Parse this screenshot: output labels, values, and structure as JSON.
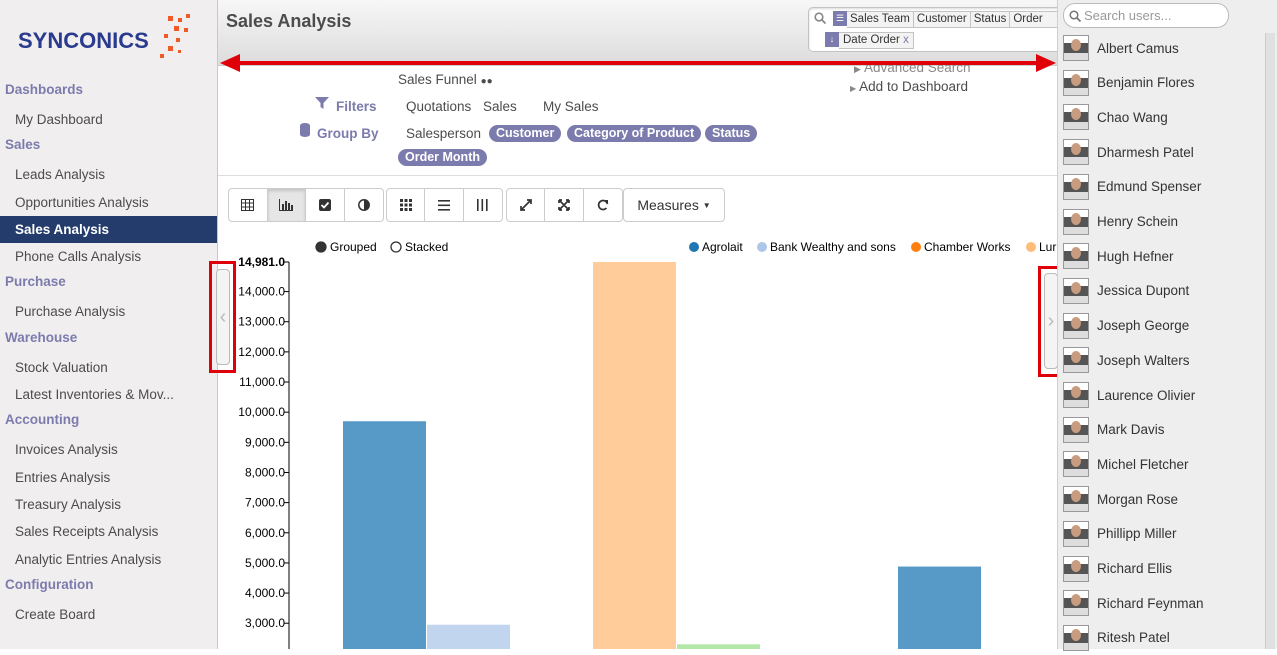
{
  "app": {
    "logo_text": "SYNCONICS",
    "accent": "#7c7bad",
    "active_bg": "#243c6b"
  },
  "sidebar": {
    "sections": [
      {
        "title": "Dashboards",
        "items": [
          {
            "label": "My Dashboard"
          }
        ]
      },
      {
        "title": "Sales",
        "items": [
          {
            "label": "Leads Analysis"
          },
          {
            "label": "Opportunities Analysis"
          },
          {
            "label": "Sales Analysis",
            "active": true
          },
          {
            "label": "Phone Calls Analysis"
          }
        ]
      },
      {
        "title": "Purchase",
        "items": [
          {
            "label": "Purchase Analysis"
          }
        ]
      },
      {
        "title": "Warehouse",
        "items": [
          {
            "label": "Stock Valuation"
          },
          {
            "label": "Latest Inventories & Mov..."
          }
        ]
      },
      {
        "title": "Accounting",
        "items": [
          {
            "label": "Invoices Analysis"
          },
          {
            "label": "Entries Analysis"
          },
          {
            "label": "Treasury Analysis"
          },
          {
            "label": "Sales Receipts Analysis"
          },
          {
            "label": "Analytic Entries Analysis"
          }
        ]
      },
      {
        "title": "Configuration",
        "items": [
          {
            "label": "Create Board"
          }
        ]
      }
    ]
  },
  "header": {
    "title": "Sales Analysis",
    "search_facets": {
      "groupby": [
        "Sales Team",
        "Customer",
        "Status",
        "Order"
      ],
      "date": "Date Order",
      "remove": "x"
    }
  },
  "drawer": {
    "sales_funnel": "Sales Funnel",
    "filters_label": "Filters",
    "filters": [
      "Quotations",
      "Sales",
      "My Sales"
    ],
    "groupby_label": "Group By",
    "groupby_plain": "Salesperson",
    "groupby_pills": [
      "Customer",
      "Category of Product",
      "Status",
      "Order Month"
    ],
    "advanced_search": "Advanced Search",
    "add_to_dashboard": "Add to Dashboard"
  },
  "toolbar": {
    "measures_label": "Measures"
  },
  "chart_data": {
    "type": "bar",
    "mode_options": [
      {
        "label": "Grouped",
        "selected": true
      },
      {
        "label": "Stacked",
        "selected": false
      }
    ],
    "legend": [
      {
        "name": "Agrolait",
        "color": "#1f77b4"
      },
      {
        "name": "Bank Wealthy and sons",
        "color": "#aec7e8"
      },
      {
        "name": "Chamber Works",
        "color": "#ff7f0e"
      },
      {
        "name": "Lur",
        "color": "#ffbb78"
      }
    ],
    "y_ticks": [
      "14,981.0",
      "14,000.0",
      "13,000.0",
      "12,000.0",
      "11,000.0",
      "10,000.0",
      "9,000.0",
      "8,000.0",
      "7,000.0",
      "6,000.0",
      "5,000.0",
      "4,000.0",
      "3,000.0"
    ],
    "ylim": [
      3000,
      14981
    ],
    "bars": [
      {
        "series": "Agrolait",
        "value": 9700,
        "color": "#1f77b4"
      },
      {
        "series": "Bank Wealthy and sons",
        "value": 2950,
        "color": "#aec7e8"
      },
      {
        "series": "Lur",
        "value": 14981,
        "color": "#ffbb78"
      },
      {
        "series": "",
        "value": 2300,
        "color": "#98df8a"
      },
      {
        "series": "Agrolait",
        "value": 4880,
        "color": "#1f77b4"
      }
    ]
  },
  "users": {
    "search_placeholder": "Search users...",
    "list": [
      "Albert Camus",
      "Benjamin Flores",
      "Chao Wang",
      "Dharmesh Patel",
      "Edmund Spenser",
      "Henry Schein",
      "Hugh Hefner",
      "Jessica Dupont",
      "Joseph George",
      "Joseph Walters",
      "Laurence Olivier",
      "Mark Davis",
      "Michel Fletcher",
      "Morgan Rose",
      "Phillipp Miller",
      "Richard Ellis",
      "Richard Feynman",
      "Ritesh Patel"
    ]
  }
}
